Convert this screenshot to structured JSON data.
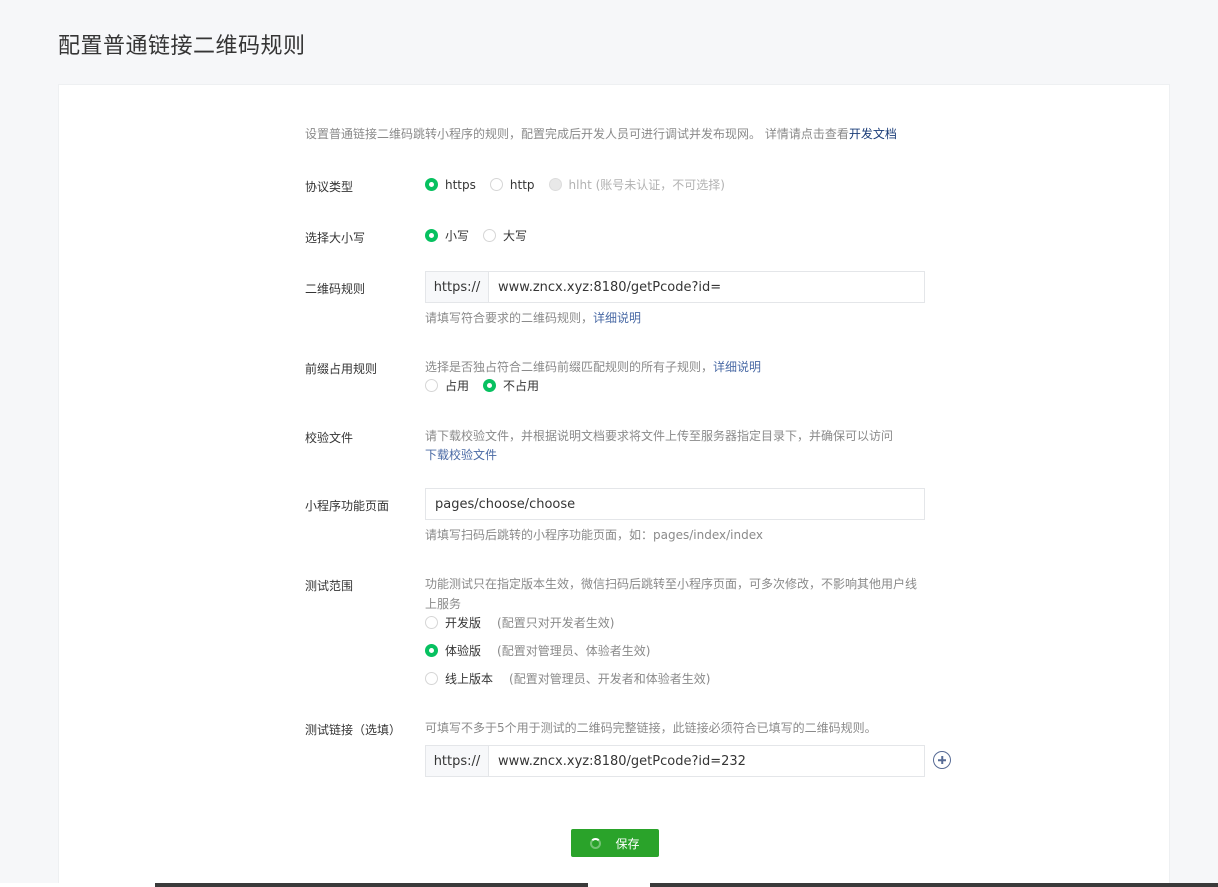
{
  "page": {
    "title": "配置普通链接二维码规则"
  },
  "intro": {
    "text": "设置普通链接二维码跳转小程序的规则，配置完成后开发人员可进行调试并发布现网。 详情请点击查看",
    "link": "开发文档"
  },
  "protocol": {
    "label": "协议类型",
    "options": [
      {
        "text": "https",
        "checked": true
      },
      {
        "text": "http",
        "checked": false
      },
      {
        "text": "hlht (账号未认证，不可选择)",
        "checked": false,
        "disabled": true
      }
    ]
  },
  "case": {
    "label": "选择大小写",
    "options": [
      {
        "text": "小写",
        "checked": true
      },
      {
        "text": "大写",
        "checked": false
      }
    ]
  },
  "qr_rule": {
    "label": "二维码规则",
    "prefix": "https://",
    "value": "www.zncx.xyz:8180/getPcode?id=",
    "hint": "请填写符合要求的二维码规则，",
    "hint_link": "详细说明"
  },
  "prefix_rule": {
    "label": "前缀占用规则",
    "hint": "选择是否独占符合二维码前缀匹配规则的所有子规则，",
    "hint_link": "详细说明",
    "options": [
      {
        "text": "占用",
        "checked": false
      },
      {
        "text": "不占用",
        "checked": true
      }
    ]
  },
  "verify_file": {
    "label": "校验文件",
    "hint": "请下载校验文件，并根据说明文档要求将文件上传至服务器指定目录下，并确保可以访问",
    "download_link": "下载校验文件"
  },
  "page_path": {
    "label": "小程序功能页面",
    "value": "pages/choose/choose",
    "hint": "请填写扫码后跳转的小程序功能页面，如：pages/index/index"
  },
  "test_scope": {
    "label": "测试范围",
    "hint_line1": "功能测试只在指定版本生效，微信扫码后跳转至小程序页面，可多次修改，不影响其他用户线",
    "hint_line2": "上服务",
    "options": [
      {
        "text": "开发版",
        "note": "(配置只对开发者生效)",
        "checked": false
      },
      {
        "text": "体验版",
        "note": "(配置对管理员、体验者生效)",
        "checked": true
      },
      {
        "text": "线上版本",
        "note": "(配置对管理员、开发者和体验者生效)",
        "checked": false
      }
    ]
  },
  "test_link": {
    "label": "测试链接（选填）",
    "hint": "可填写不多于5个用于测试的二维码完整链接，此链接必须符合已填写的二维码规则。",
    "prefix": "https://",
    "value": "www.zncx.xyz:8180/getPcode?id=232",
    "add_icon": "plus-circle-icon"
  },
  "save": {
    "label": "保存"
  },
  "colors": {
    "accent": "#07c160",
    "button": "#2aa32a",
    "link": "#576b95"
  }
}
